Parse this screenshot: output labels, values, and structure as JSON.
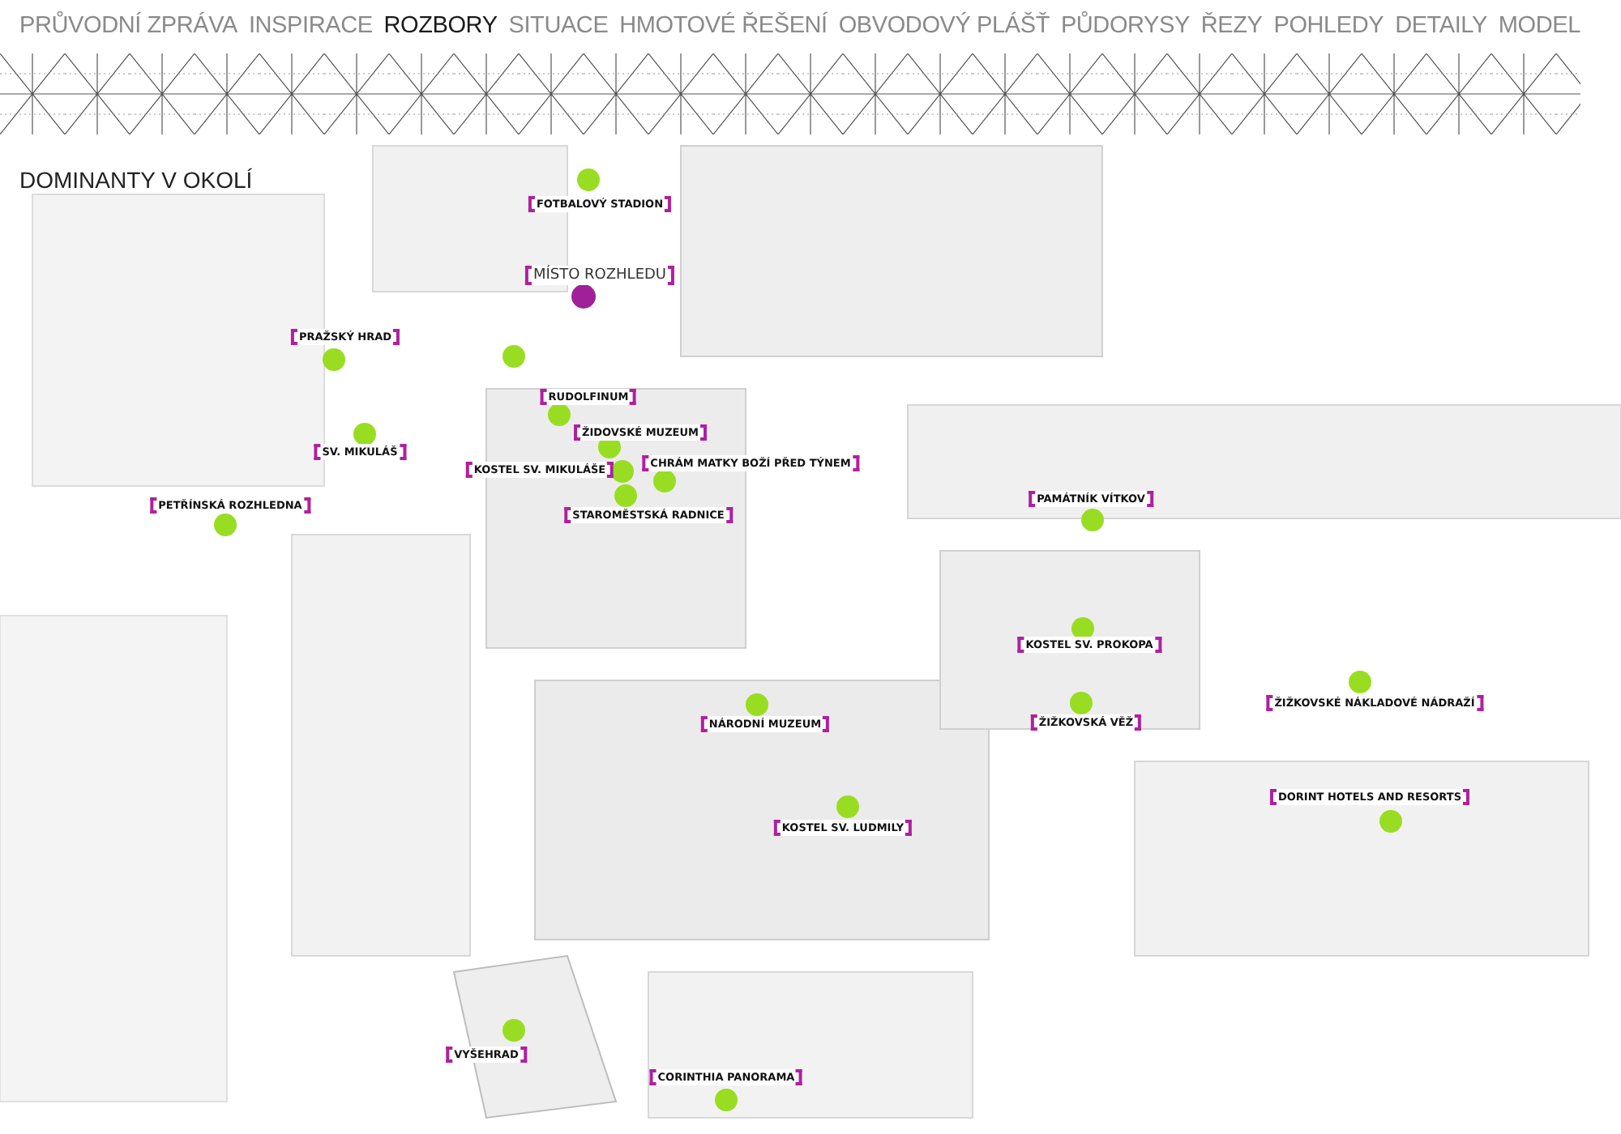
{
  "nav": [
    {
      "label": "PRŮVODNÍ ZPRÁVA",
      "selected": false
    },
    {
      "label": "INSPIRACE",
      "selected": false
    },
    {
      "label": "ROZBORY",
      "selected": true
    },
    {
      "label": "SITUACE",
      "selected": false
    },
    {
      "label": "HMOTOVÉ ŘEŠENÍ",
      "selected": false
    },
    {
      "label": "OBVODOVÝ PLÁŠŤ",
      "selected": false
    },
    {
      "label": "PŮDORYSY",
      "selected": false
    },
    {
      "label": "ŘEZY",
      "selected": false
    },
    {
      "label": "POHLEDY",
      "selected": false
    },
    {
      "label": "DETAILY",
      "selected": false
    },
    {
      "label": "MODEL",
      "selected": false
    }
  ],
  "heading": "DOMINANTY V OKOLÍ",
  "map": {
    "places": [
      {
        "kind": "landmark",
        "label": "FOTBALOVÝ STADION",
        "color": "#99dd22"
      },
      {
        "kind": "viewpoint",
        "label": "MÍSTO ROZHLEDU",
        "color": "#a0209a"
      },
      {
        "kind": "landmark",
        "label": "PRAŽSKÝ HRAD",
        "color": "#99dd22"
      },
      {
        "kind": "landmark",
        "color": "#99dd22"
      },
      {
        "kind": "landmark",
        "label": "RUDOLFINUM",
        "color": "#99dd22"
      },
      {
        "kind": "landmark",
        "label": "SV. MIKULÁŠ",
        "color": "#99dd22"
      },
      {
        "kind": "landmark",
        "label": "ŽIDOVSKÉ MUZEUM",
        "color": "#99dd22"
      },
      {
        "kind": "landmark",
        "label": "KOSTEL SV. MIKULÁŠE",
        "color": "#99dd22"
      },
      {
        "kind": "landmark",
        "label": "CHRÁM MATKY BOŽÍ PŘED TÝNEM",
        "color": "#99dd22"
      },
      {
        "kind": "landmark",
        "label": "STAROMĚSTSKÁ RADNICE",
        "color": "#99dd22"
      },
      {
        "kind": "landmark",
        "label": "PETŘÍNSKÁ ROZHLEDNA",
        "color": "#99dd22"
      },
      {
        "kind": "landmark",
        "label": "PAMÁTNÍK VÍTKOV",
        "color": "#99dd22"
      },
      {
        "kind": "landmark",
        "label": "KOSTEL SV. PROKOPA",
        "color": "#99dd22"
      },
      {
        "kind": "landmark",
        "label": "NÁRODNÍ MUZEUM",
        "color": "#99dd22"
      },
      {
        "kind": "landmark",
        "label": "ŽIŽKOVSKÁ VĚŽ",
        "color": "#99dd22"
      },
      {
        "kind": "landmark",
        "label": "ŽIŽKOVSKÉ NÁKLADOVÉ NÁDRAŽÍ",
        "color": "#99dd22"
      },
      {
        "kind": "landmark",
        "label": "KOSTEL SV. LUDMILY",
        "color": "#99dd22"
      },
      {
        "kind": "landmark",
        "label": "DORINT HOTELS AND RESORTS",
        "color": "#99dd22"
      },
      {
        "kind": "landmark",
        "label": "VYŠEHRAD",
        "color": "#99dd22"
      },
      {
        "kind": "landmark",
        "label": "CORINTHIA PANORAMA",
        "color": "#99dd22"
      }
    ]
  }
}
